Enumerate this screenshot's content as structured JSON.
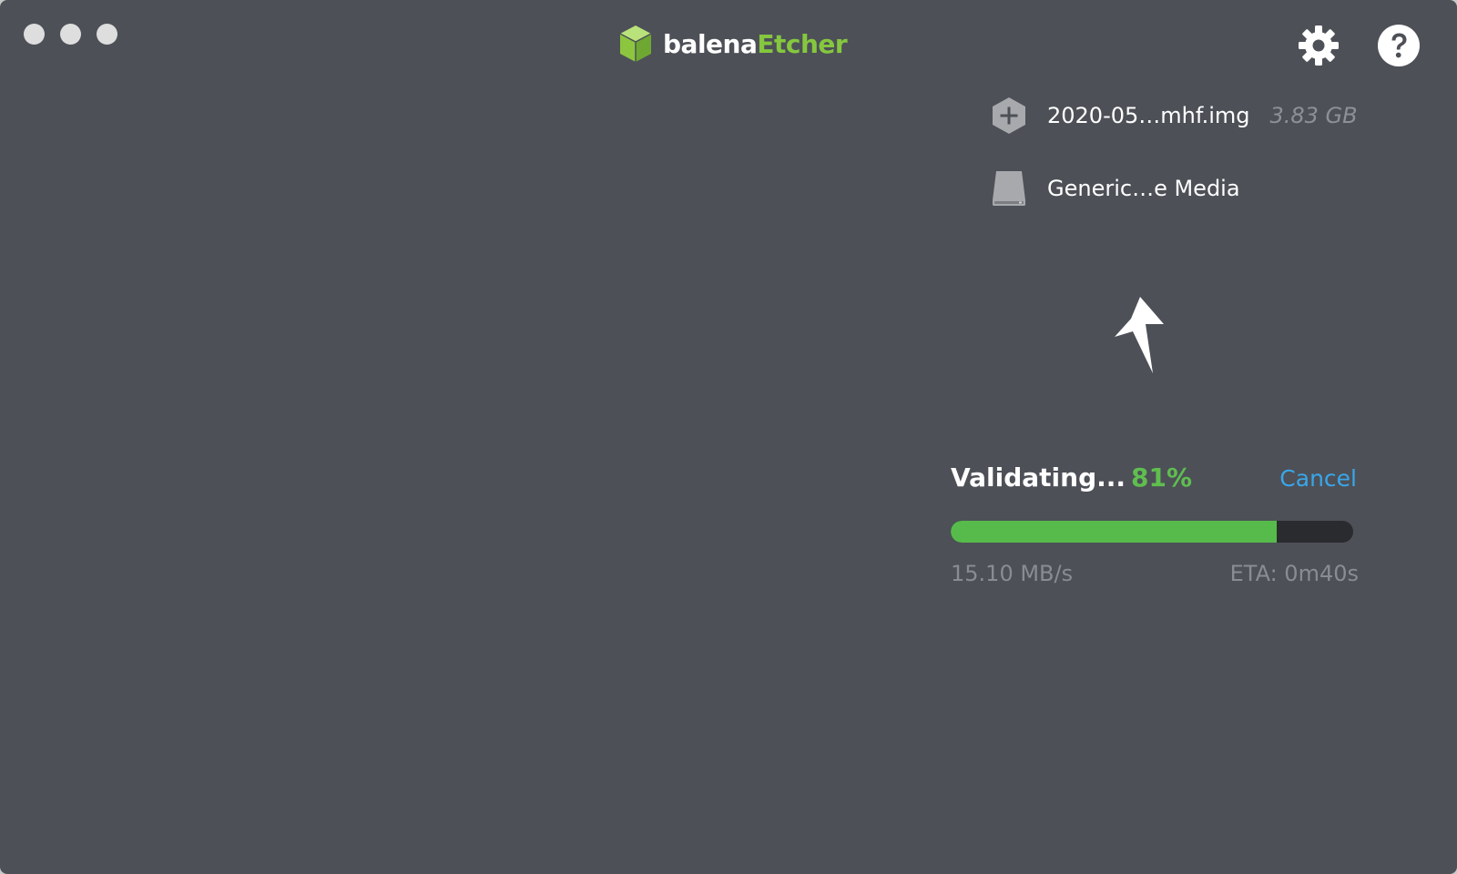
{
  "window": {
    "controls": [
      "close",
      "minimize",
      "maximize"
    ]
  },
  "brand": {
    "part1": "balena",
    "part2": "Etcher",
    "accent_color": "#85c73f",
    "logo_icon": "cube-logo-icon"
  },
  "toolbar": {
    "settings_icon": "gear-icon",
    "help_icon": "help-circle-icon"
  },
  "source": {
    "icon": "hexagon-plus-icon",
    "name": "2020-05…mhf.img",
    "size": "3.83 GB"
  },
  "target": {
    "icon": "drive-icon",
    "name": "Generic…e Media"
  },
  "flash": {
    "icon": "lightning-bolt-icon"
  },
  "progress": {
    "status": "Validating...",
    "percent_label": "81%",
    "percent": 0.81,
    "cancel_label": "Cancel",
    "speed": "15.10 MB/s",
    "eta": "ETA: 0m40s",
    "fill_color": "#56bb4b",
    "cancel_color": "#3aa6e8"
  }
}
